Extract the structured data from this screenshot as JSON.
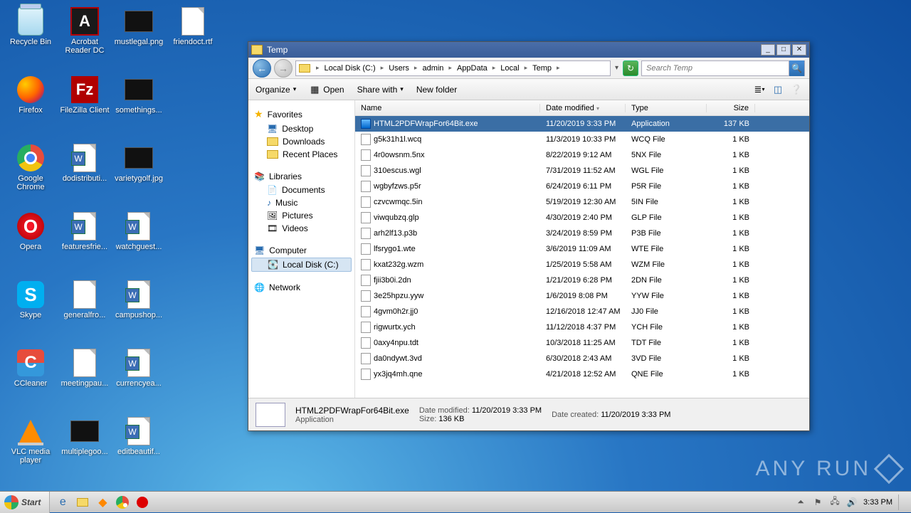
{
  "desktop_icons": [
    {
      "label": "Recycle Bin",
      "kind": "bin"
    },
    {
      "label": "Acrobat Reader DC",
      "kind": "adobe"
    },
    {
      "label": "mustlegal.png",
      "kind": "image"
    },
    {
      "label": "friendoct.rtf",
      "kind": "page"
    },
    {
      "label": "Firefox",
      "kind": "ff"
    },
    {
      "label": "FileZilla Client",
      "kind": "fz"
    },
    {
      "label": "somethings...",
      "kind": "image"
    },
    {
      "label": "",
      "kind": "empty"
    },
    {
      "label": "Google Chrome",
      "kind": "chrome"
    },
    {
      "label": "dodistributi...",
      "kind": "pagew"
    },
    {
      "label": "varietygolf.jpg",
      "kind": "image"
    },
    {
      "label": "",
      "kind": "empty"
    },
    {
      "label": "Opera",
      "kind": "opera"
    },
    {
      "label": "featuresfrie...",
      "kind": "pagew"
    },
    {
      "label": "watchguest...",
      "kind": "pagew"
    },
    {
      "label": "",
      "kind": "empty"
    },
    {
      "label": "Skype",
      "kind": "skype"
    },
    {
      "label": "generalfro...",
      "kind": "page"
    },
    {
      "label": "campushop...",
      "kind": "pagew"
    },
    {
      "label": "",
      "kind": "empty"
    },
    {
      "label": "CCleaner",
      "kind": "ccleaner"
    },
    {
      "label": "meetingpau...",
      "kind": "page"
    },
    {
      "label": "currencyea...",
      "kind": "pagew"
    },
    {
      "label": "",
      "kind": "empty"
    },
    {
      "label": "VLC media player",
      "kind": "vlc"
    },
    {
      "label": "multiplegoo...",
      "kind": "image"
    },
    {
      "label": "editbeautif...",
      "kind": "pagew"
    },
    {
      "label": "",
      "kind": "empty"
    }
  ],
  "window": {
    "title": "Temp",
    "breadcrumb": [
      "Local Disk (C:)",
      "Users",
      "admin",
      "AppData",
      "Local",
      "Temp"
    ],
    "search_placeholder": "Search Temp",
    "toolbar": {
      "organize": "Organize",
      "open": "Open",
      "share": "Share with",
      "newfolder": "New folder"
    },
    "sidebar": {
      "favorites": "Favorites",
      "desktop": "Desktop",
      "downloads": "Downloads",
      "recent": "Recent Places",
      "libraries": "Libraries",
      "documents": "Documents",
      "music": "Music",
      "pictures": "Pictures",
      "videos": "Videos",
      "computer": "Computer",
      "localdisk": "Local Disk (C:)",
      "network": "Network"
    },
    "columns": {
      "name": "Name",
      "date": "Date modified",
      "type": "Type",
      "size": "Size"
    },
    "files": [
      {
        "name": "HTML2PDFWrapFor64Bit.exe",
        "date": "11/20/2019 3:33 PM",
        "type": "Application",
        "size": "137 KB",
        "sel": true,
        "exe": true
      },
      {
        "name": "g5k31h1l.wcq",
        "date": "11/3/2019 10:33 PM",
        "type": "WCQ File",
        "size": "1 KB"
      },
      {
        "name": "4r0owsnm.5nx",
        "date": "8/22/2019 9:12 AM",
        "type": "5NX File",
        "size": "1 KB"
      },
      {
        "name": "310escus.wgl",
        "date": "7/31/2019 11:52 AM",
        "type": "WGL File",
        "size": "1 KB"
      },
      {
        "name": "wgbyfzws.p5r",
        "date": "6/24/2019 6:11 PM",
        "type": "P5R File",
        "size": "1 KB"
      },
      {
        "name": "czvcwmqc.5in",
        "date": "5/19/2019 12:30 AM",
        "type": "5IN File",
        "size": "1 KB"
      },
      {
        "name": "viwqubzq.glp",
        "date": "4/30/2019 2:40 PM",
        "type": "GLP File",
        "size": "1 KB"
      },
      {
        "name": "arh2lf13.p3b",
        "date": "3/24/2019 8:59 PM",
        "type": "P3B File",
        "size": "1 KB"
      },
      {
        "name": "lfsrygo1.wte",
        "date": "3/6/2019 11:09 AM",
        "type": "WTE File",
        "size": "1 KB"
      },
      {
        "name": "kxat232g.wzm",
        "date": "1/25/2019 5:58 AM",
        "type": "WZM File",
        "size": "1 KB"
      },
      {
        "name": "fjii3b0i.2dn",
        "date": "1/21/2019 6:28 PM",
        "type": "2DN File",
        "size": "1 KB"
      },
      {
        "name": "3e25hpzu.yyw",
        "date": "1/6/2019 8:08 PM",
        "type": "YYW File",
        "size": "1 KB"
      },
      {
        "name": "4gvm0h2r.jj0",
        "date": "12/16/2018 12:47 AM",
        "type": "JJ0 File",
        "size": "1 KB"
      },
      {
        "name": "rigwurtx.ych",
        "date": "11/12/2018 4:37 PM",
        "type": "YCH File",
        "size": "1 KB"
      },
      {
        "name": "0axy4npu.tdt",
        "date": "10/3/2018 11:25 AM",
        "type": "TDT File",
        "size": "1 KB"
      },
      {
        "name": "da0ndywt.3vd",
        "date": "6/30/2018 2:43 AM",
        "type": "3VD File",
        "size": "1 KB"
      },
      {
        "name": "yx3jq4mh.qne",
        "date": "4/21/2018 12:52 AM",
        "type": "QNE File",
        "size": "1 KB"
      }
    ],
    "details": {
      "filename": "HTML2PDFWrapFor64Bit.exe",
      "filetype": "Application",
      "date_modified_label": "Date modified:",
      "date_modified": "11/20/2019 3:33 PM",
      "size_label": "Size:",
      "size": "136 KB",
      "date_created_label": "Date created:",
      "date_created": "11/20/2019 3:33 PM"
    }
  },
  "taskbar": {
    "start": "Start",
    "clock": "3:33 PM"
  },
  "watermark": "ANY RUN"
}
